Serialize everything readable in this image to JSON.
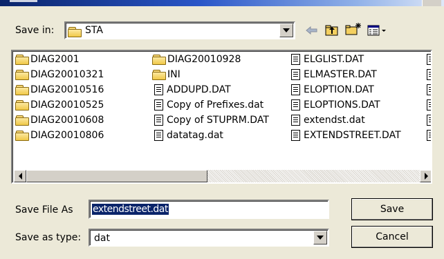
{
  "dialog": {
    "save_in_label": "Save in:",
    "save_in_value": "STA",
    "file_name_label": "Save File As",
    "file_name_value": "extendstreet.dat",
    "file_type_label": "Save as type:",
    "file_type_value": "dat",
    "save_button": "Save",
    "cancel_button": "Cancel"
  },
  "toolbar": {
    "back_icon": "back-arrow-icon",
    "up_icon": "up-folder-icon",
    "new_folder_icon": "new-folder-icon",
    "view_icon": "view-menu-icon"
  },
  "files": {
    "col1": [
      {
        "name": "DIAG2001",
        "type": "folder"
      },
      {
        "name": "DIAG20010321",
        "type": "folder"
      },
      {
        "name": "DIAG20010516",
        "type": "folder"
      },
      {
        "name": "DIAG20010525",
        "type": "folder"
      },
      {
        "name": "DIAG20010608",
        "type": "folder"
      },
      {
        "name": "DIAG20010806",
        "type": "folder"
      }
    ],
    "col2": [
      {
        "name": "DIAG20010928",
        "type": "folder"
      },
      {
        "name": "INI",
        "type": "folder"
      },
      {
        "name": "ADDUPD.DAT",
        "type": "file"
      },
      {
        "name": "Copy of Prefixes.dat",
        "type": "file"
      },
      {
        "name": "Copy of STUPRM.DAT",
        "type": "file"
      },
      {
        "name": "datatag.dat",
        "type": "file"
      }
    ],
    "col3": [
      {
        "name": "ELGLIST.DAT",
        "type": "file"
      },
      {
        "name": "ELMASTER.DAT",
        "type": "file"
      },
      {
        "name": "ELOPTION.DAT",
        "type": "file"
      },
      {
        "name": "ELOPTIONS.DAT",
        "type": "file"
      },
      {
        "name": "extendst.dat",
        "type": "file"
      },
      {
        "name": "EXTENDSTREET.DAT",
        "type": "file"
      }
    ]
  }
}
